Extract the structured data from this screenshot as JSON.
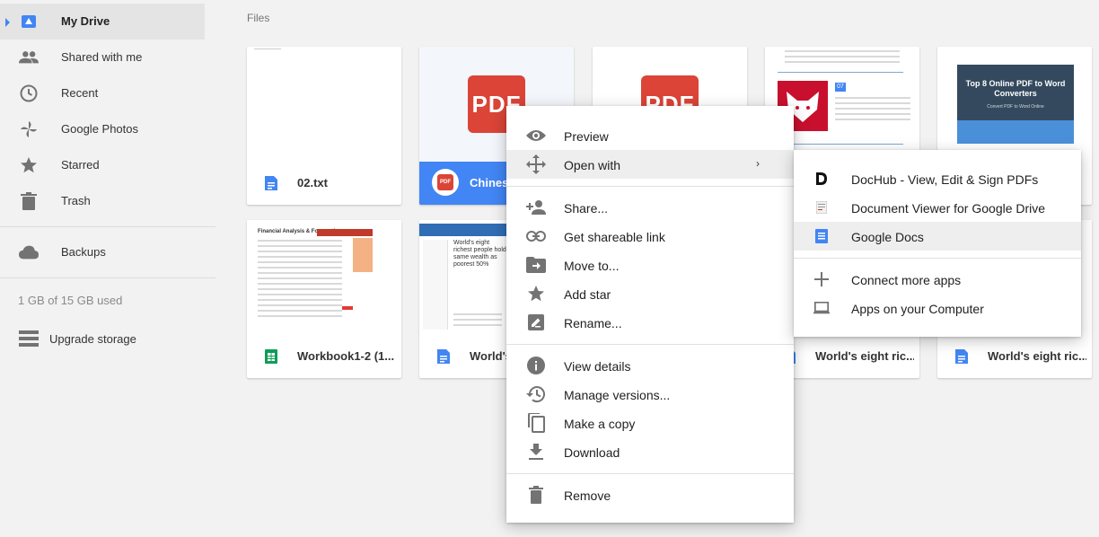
{
  "sidebar": {
    "items": [
      {
        "label": "My Drive",
        "icon": "drive-icon"
      },
      {
        "label": "Shared with me",
        "icon": "people-icon"
      },
      {
        "label": "Recent",
        "icon": "clock-icon"
      },
      {
        "label": "Google Photos",
        "icon": "pinwheel-icon"
      },
      {
        "label": "Starred",
        "icon": "star-icon"
      },
      {
        "label": "Trash",
        "icon": "trash-icon"
      },
      {
        "label": "Backups",
        "icon": "cloud-icon"
      }
    ],
    "storage": "1 GB of 15 GB used",
    "upgrade_label": "Upgrade storage"
  },
  "main": {
    "section_title": "Files",
    "files": [
      {
        "name": "02.txt",
        "type": "doc"
      },
      {
        "name": "Chines",
        "type": "pdf"
      },
      {
        "name": "",
        "type": "pdf"
      },
      {
        "name": "",
        "type": "doc"
      },
      {
        "name": "",
        "type": "doc"
      },
      {
        "name": "Workbook1-2 (1...",
        "type": "sheet"
      },
      {
        "name": "World's",
        "type": "doc"
      },
      {
        "name": "",
        "type": "doc"
      },
      {
        "name": "World's eight ric...",
        "type": "doc"
      },
      {
        "name": "World's eight ric...",
        "type": "doc"
      }
    ],
    "thumb_texts": {
      "top8_title": "Top 8 Online PDF to Word Converters",
      "top8_sub": "Convert PDF to Word Online",
      "badge_07": "07",
      "workbook_heading": "Financial Analysis & Forecasting",
      "worlds_heading": "World's eight richest people hold same wealth as poorest 50%"
    }
  },
  "context_menu": {
    "items": [
      {
        "label": "Preview",
        "icon": "eye-icon"
      },
      {
        "label": "Open with",
        "icon": "move-arrows-icon",
        "arrow": "›"
      },
      {
        "label": "Share...",
        "icon": "person-add-icon"
      },
      {
        "label": "Get shareable link",
        "icon": "link-icon"
      },
      {
        "label": "Move to...",
        "icon": "folder-move-icon"
      },
      {
        "label": "Add star",
        "icon": "star-icon"
      },
      {
        "label": "Rename...",
        "icon": "pencil-icon"
      },
      {
        "label": "View details",
        "icon": "info-icon"
      },
      {
        "label": "Manage versions...",
        "icon": "history-icon"
      },
      {
        "label": "Make a copy",
        "icon": "copy-icon"
      },
      {
        "label": "Download",
        "icon": "download-icon"
      },
      {
        "label": "Remove",
        "icon": "trash-icon"
      }
    ]
  },
  "submenu": {
    "items": [
      {
        "label": "DocHub - View, Edit & Sign PDFs",
        "icon": "dochub-icon"
      },
      {
        "label": "Document Viewer for Google Drive",
        "icon": "document-viewer-icon"
      },
      {
        "label": "Google Docs",
        "icon": "google-docs-icon"
      },
      {
        "label": "Connect more apps",
        "icon": "plus-icon"
      },
      {
        "label": "Apps on your Computer",
        "icon": "laptop-icon"
      }
    ]
  },
  "colors": {
    "accent": "#4285f4",
    "pdf_red": "#db4437",
    "sheet_green": "#0f9d58",
    "icon_grey": "#737373"
  }
}
